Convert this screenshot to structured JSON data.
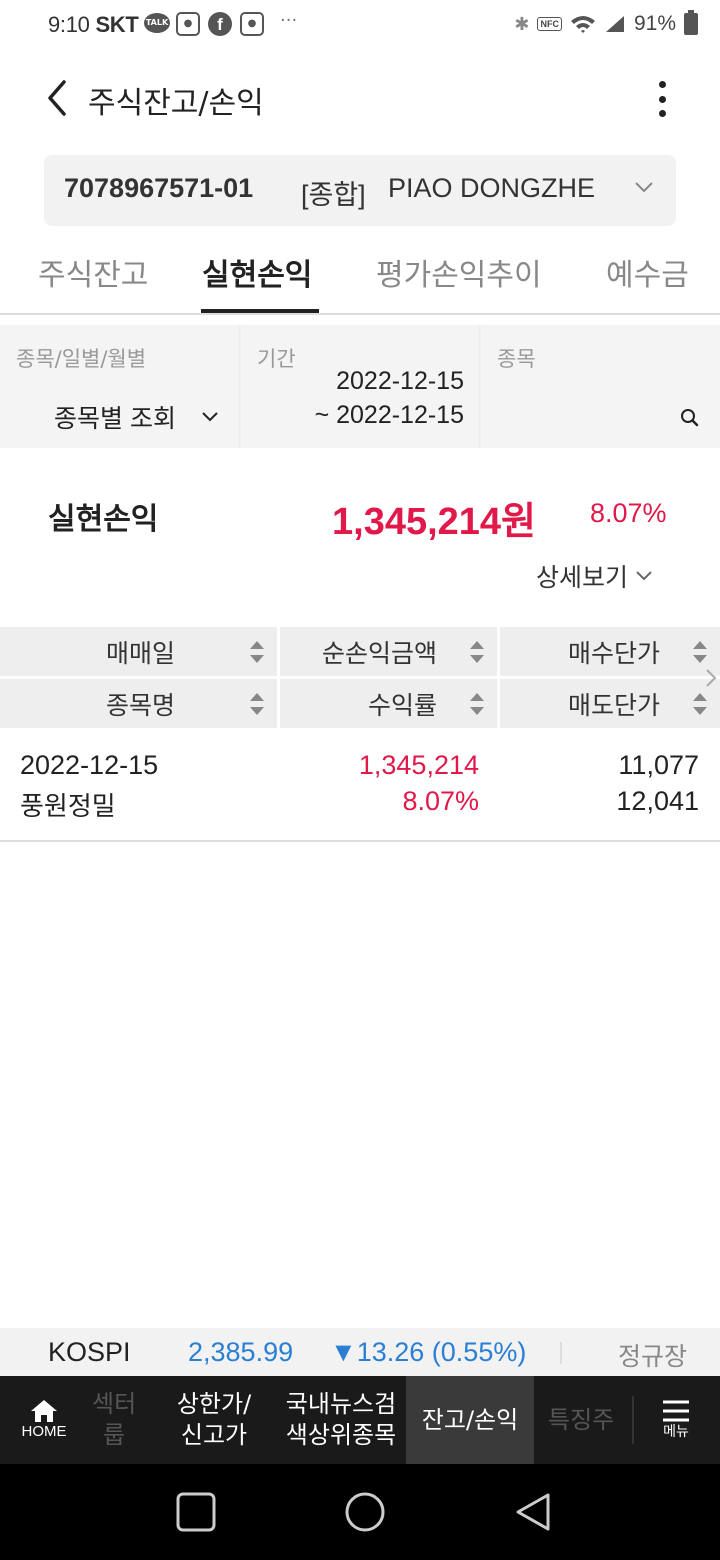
{
  "status_bar": {
    "time": "9:10",
    "carrier": "SKT",
    "battery": "91%",
    "dots": "···"
  },
  "header": {
    "title": "주식잔고/손익"
  },
  "account": {
    "number": "7078967571-01",
    "type": "[종합]",
    "name": "PIAO DONGZHE"
  },
  "tabs": [
    {
      "label": "주식잔고",
      "active": false
    },
    {
      "label": "실현손익",
      "active": true
    },
    {
      "label": "평가손익추이",
      "active": false
    },
    {
      "label": "예수금",
      "active": false
    }
  ],
  "filter": {
    "mode_label": "종목/일별/월별",
    "mode_value": "종목별 조회",
    "period_label": "기간",
    "period_from": "2022-12-15",
    "period_to": "~ 2022-12-15",
    "stock_label": "종목"
  },
  "summary": {
    "label": "실현손익",
    "amount": "1,345,214원",
    "rate": "8.07%",
    "detail_label": "상세보기"
  },
  "table": {
    "header_row1": [
      "매매일",
      "순손익금액",
      "매수단가"
    ],
    "header_row2": [
      "종목명",
      "수익률",
      "매도단가"
    ],
    "rows": [
      {
        "date": "2022-12-15",
        "stock": "풍원정밀",
        "net_profit": "1,345,214",
        "rate": "8.07%",
        "buy_price": "11,077",
        "sell_price": "12,041"
      }
    ]
  },
  "market_bar": {
    "index_name": "KOSPI",
    "index_value": "2,385.99",
    "change": "▼13.26 (0.55%)",
    "session": "정규장"
  },
  "bottom_nav": {
    "home": "HOME",
    "items": [
      "섹터\n룹",
      "상한가/\n신고가",
      "국내뉴스검\n색상위종목",
      "잔고/손익",
      "특징주"
    ],
    "menu": "메뉴"
  },
  "colors": {
    "profit_red": "#e0194a",
    "index_blue": "#2a7fd4"
  }
}
